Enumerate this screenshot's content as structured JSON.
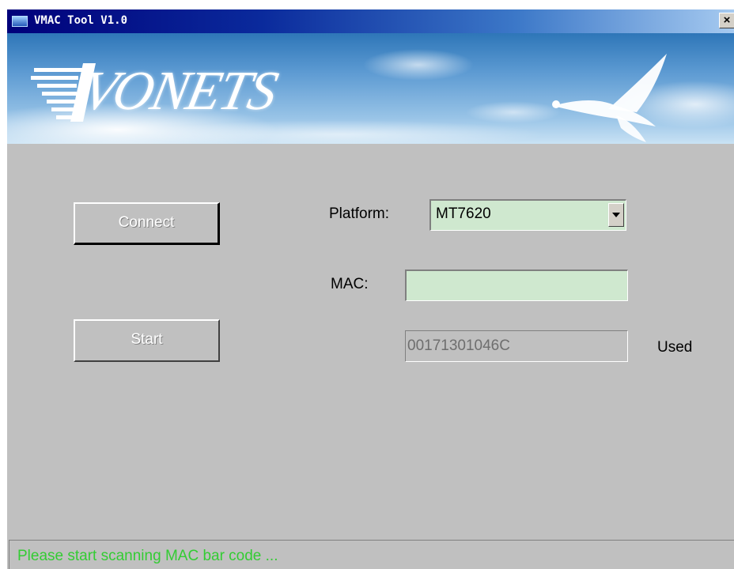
{
  "window": {
    "title": "VMAC Tool V1.0",
    "close_glyph": "✕"
  },
  "banner": {
    "logo_text": "VONETS"
  },
  "buttons": {
    "connect_label": "Connect",
    "start_label": "Start"
  },
  "form": {
    "platform_label": "Platform:",
    "platform_value": "MT7620",
    "mac_label": "MAC:",
    "mac_value": "",
    "used_mac_value": "00171301046C",
    "used_label": "Used"
  },
  "status": {
    "message": "Please start scanning MAC bar code ...",
    "color": "#33cc33"
  },
  "icons": {
    "app": "app-icon",
    "close": "close-icon",
    "dropdown": "chevron-down-icon"
  }
}
